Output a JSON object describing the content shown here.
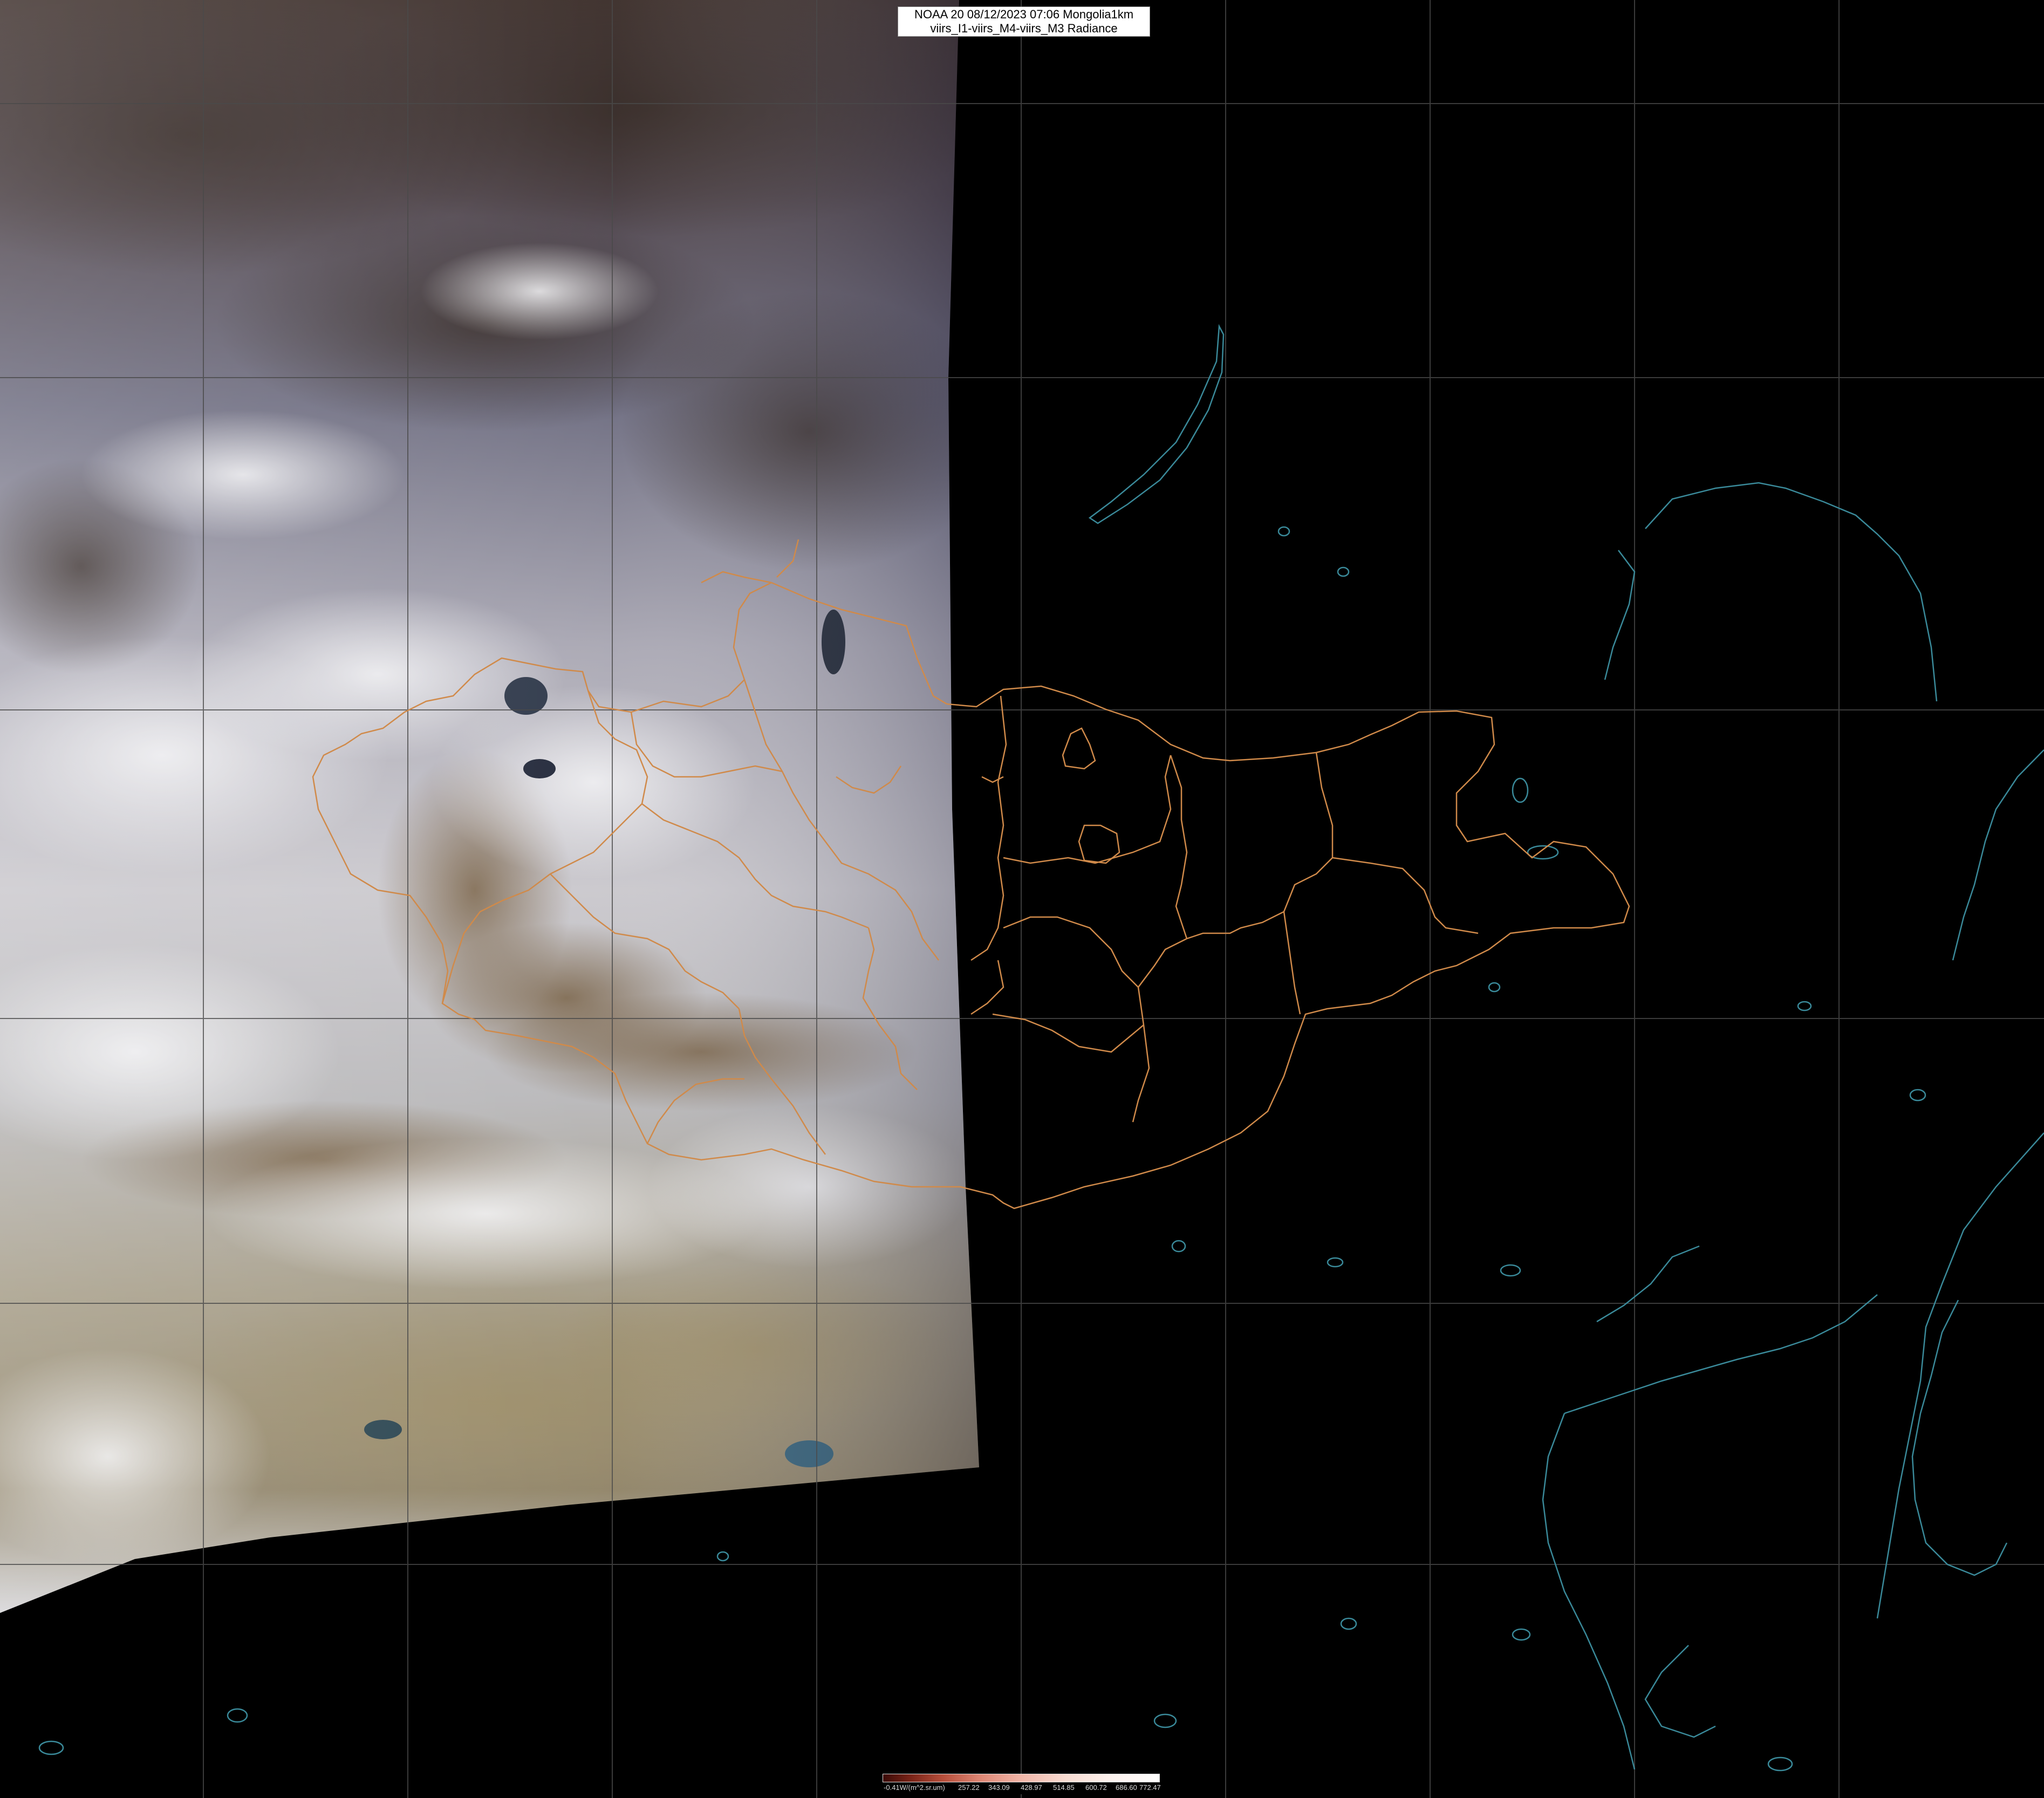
{
  "title": {
    "line1": "NOAA 20 08/12/2023 07:06 Mongolia1km",
    "line2": "viirs_I1-viirs_M4-viirs_M3 Radiance"
  },
  "colorbar": {
    "unit_label": "-0.41W/(m^2.sr.um)",
    "ticks": [
      "257.22",
      "343.09",
      "428.97",
      "514.85",
      "600.72",
      "686.60",
      "772.47"
    ]
  },
  "colors": {
    "background": "#000000",
    "admin_border": "#d08a4a",
    "coast_border": "#3a8a9a",
    "graticule": "#4a4a4a"
  }
}
